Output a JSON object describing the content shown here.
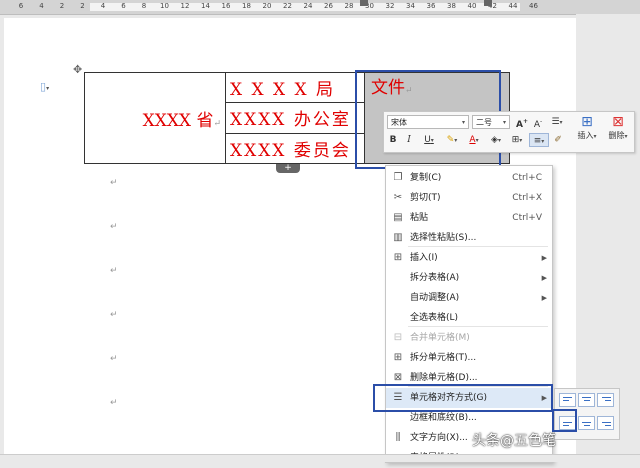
{
  "ruler": {
    "labels": [
      "6",
      "4",
      "2",
      "2",
      "4",
      "6",
      "8",
      "10",
      "12",
      "14",
      "16",
      "18",
      "20",
      "22",
      "24",
      "26",
      "28",
      "30",
      "32",
      "34",
      "36",
      "38",
      "40",
      "42",
      "44",
      "46"
    ]
  },
  "document": {
    "table": {
      "left_cell": "XXXX 省",
      "rows": [
        "X X X X  局",
        "XXXX 办公室",
        "XXXX 委员会"
      ],
      "right_top_text": "文件"
    },
    "paragraph_mark": "↵"
  },
  "format_bar": {
    "font_name": "宋体",
    "font_size": "二号",
    "bold_label": "B",
    "italic_label": "I",
    "underline_label": "U",
    "insert_label": "插入",
    "delete_label": "删除",
    "grow_label": "A",
    "shrink_label": "A"
  },
  "context_menu": {
    "items": [
      {
        "label": "复制(C)",
        "shortcut": "Ctrl+C",
        "icon": "copy-icon",
        "disabled": false
      },
      {
        "label": "剪切(T)",
        "shortcut": "Ctrl+X",
        "icon": "scissors-icon",
        "disabled": false
      },
      {
        "label": "粘贴",
        "shortcut": "Ctrl+V",
        "icon": "paste-icon",
        "disabled": false
      },
      {
        "label": "选择性粘贴(S)...",
        "shortcut": "",
        "icon": "paste-special-icon",
        "disabled": false
      },
      {
        "label": "插入(I)",
        "shortcut": "",
        "icon": "table-insert-icon",
        "disabled": false,
        "submenu": true
      },
      {
        "label": "拆分表格(A)",
        "shortcut": "",
        "icon": "",
        "disabled": false,
        "submenu": true
      },
      {
        "label": "自动调整(A)",
        "shortcut": "",
        "icon": "",
        "disabled": false,
        "submenu": true
      },
      {
        "label": "全选表格(L)",
        "shortcut": "",
        "icon": "",
        "disabled": false
      },
      {
        "label": "合并单元格(M)",
        "shortcut": "",
        "icon": "merge-cells-icon",
        "disabled": true
      },
      {
        "label": "拆分单元格(T)...",
        "shortcut": "",
        "icon": "split-cells-icon",
        "disabled": false
      },
      {
        "label": "删除单元格(D)...",
        "shortcut": "",
        "icon": "delete-cells-icon",
        "disabled": false
      },
      {
        "label": "单元格对齐方式(G)",
        "shortcut": "",
        "icon": "cell-align-icon",
        "disabled": false,
        "submenu": true,
        "highlighted": true
      },
      {
        "label": "边框和底纹(B)...",
        "shortcut": "",
        "icon": "",
        "disabled": false
      },
      {
        "label": "文字方向(X)...",
        "shortcut": "",
        "icon": "text-direction-icon",
        "disabled": false
      },
      {
        "label": "表格属性(R)...",
        "shortcut": "",
        "icon": "",
        "disabled": false
      }
    ]
  },
  "watermark": "头条@五色笔",
  "colors": {
    "accent": "#2b4ea8",
    "red_text": "#e00000",
    "selected_cell": "#c4c4c4"
  }
}
